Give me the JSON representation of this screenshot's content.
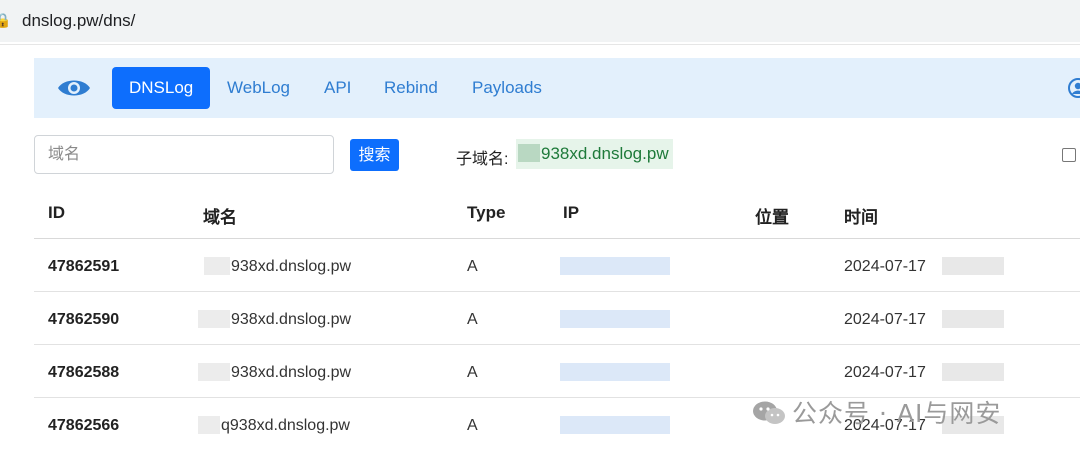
{
  "browser": {
    "url": "dnslog.pw/dns/",
    "lock_icon": "site-info-icon"
  },
  "navbar": {
    "logo_icon": "eye-icon",
    "items": [
      {
        "label": "DNSLog",
        "active": true
      },
      {
        "label": "WebLog",
        "active": false
      },
      {
        "label": "API",
        "active": false
      },
      {
        "label": "Rebind",
        "active": false
      },
      {
        "label": "Payloads",
        "active": false
      }
    ],
    "user_icon": "user-icon",
    "accent": "#0d6efd",
    "background": "#e3f0fc"
  },
  "search": {
    "placeholder": "域名",
    "value": "",
    "button_label": "搜索",
    "subdomain_label": "子域名:",
    "subdomain_value": "938xd.dnslog.pw"
  },
  "table": {
    "headers": [
      "ID",
      "域名",
      "Type",
      "IP",
      "位置",
      "时间"
    ],
    "rows": [
      {
        "id": "47862591",
        "domain": "938xd.dnslog.pw",
        "type": "A",
        "ip": "",
        "location": "",
        "time": "2024-07-17"
      },
      {
        "id": "47862590",
        "domain": "938xd.dnslog.pw",
        "type": "A",
        "ip": "",
        "location": "",
        "time": "2024-07-17"
      },
      {
        "id": "47862588",
        "domain": "938xd.dnslog.pw",
        "type": "A",
        "ip": "",
        "location": "",
        "time": "2024-07-17"
      },
      {
        "id": "47862566",
        "domain": "q938xd.dnslog.pw",
        "type": "A",
        "ip": "",
        "location": "",
        "time": "2024-07-17"
      }
    ]
  },
  "watermark": {
    "text": "公众号 · AI与网安",
    "icon": "wechat-icon"
  }
}
